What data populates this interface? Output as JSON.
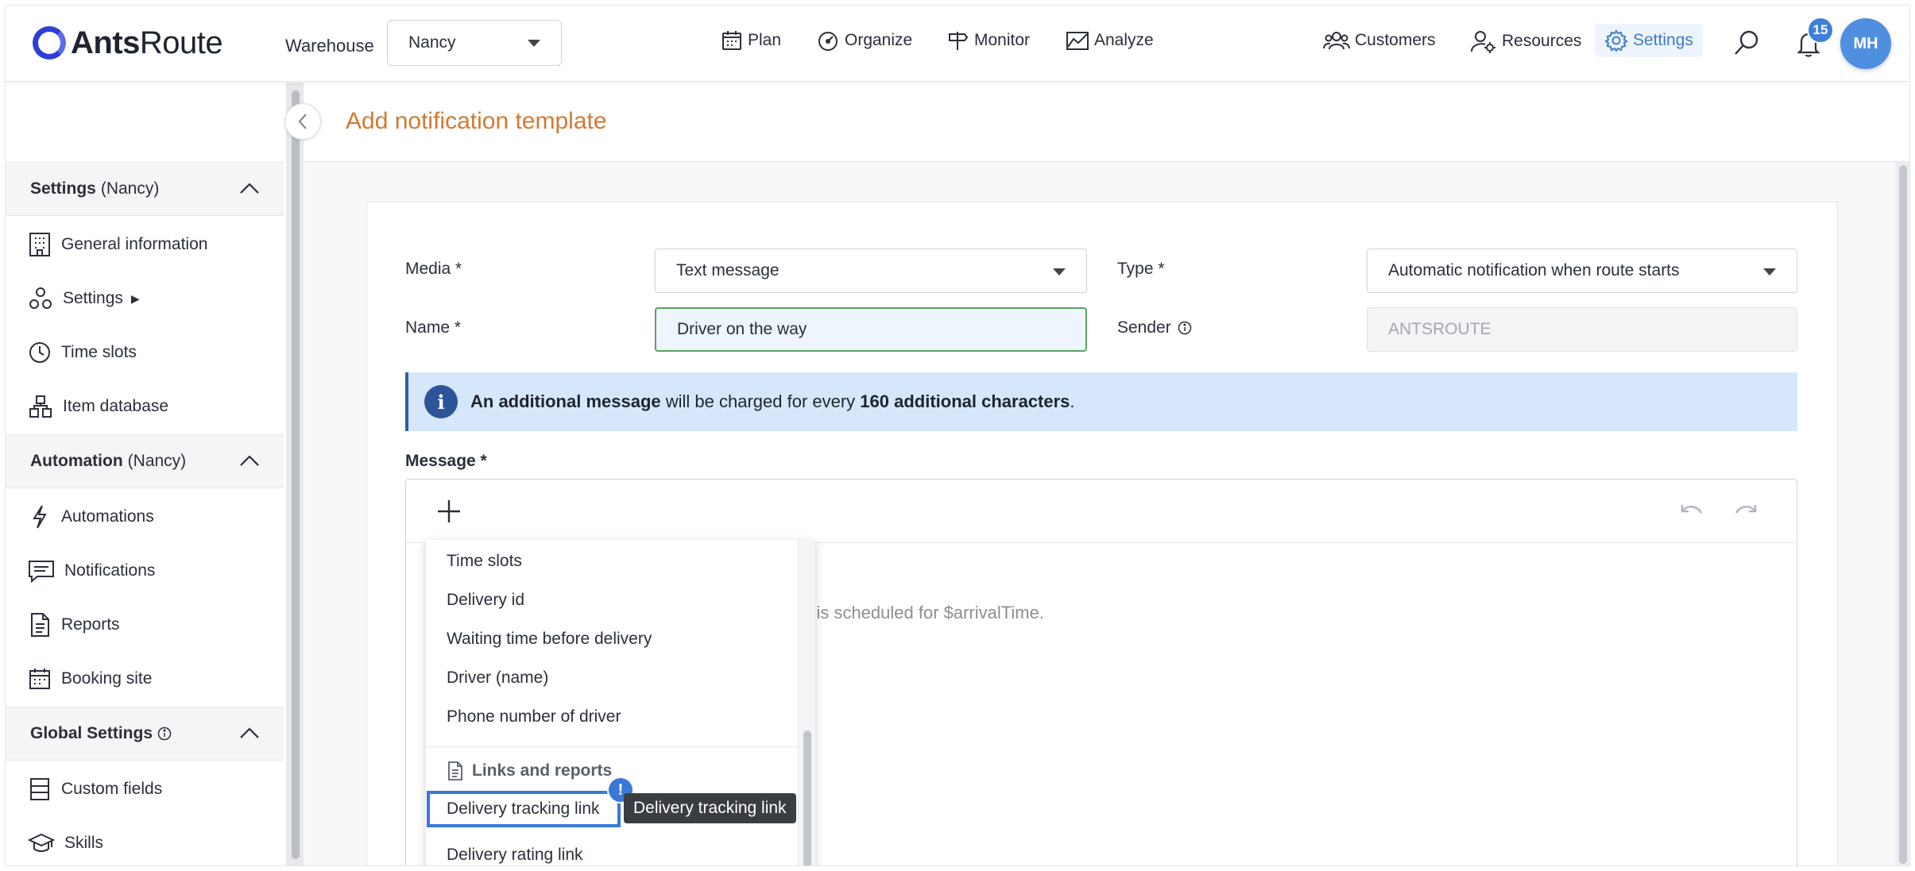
{
  "app": {
    "logo_bold": "Ants",
    "logo_light": "Route"
  },
  "header": {
    "warehouse_label": "Warehouse",
    "warehouse_value": "Nancy",
    "nav": {
      "plan": "Plan",
      "organize": "Organize",
      "monitor": "Monitor",
      "analyze": "Analyze",
      "customers": "Customers",
      "resources": "Resources",
      "settings": "Settings"
    },
    "notification_count": "15",
    "avatar_initials": "MH"
  },
  "sidebar": {
    "settings_section": {
      "title": "Settings",
      "scope": "(Nancy)"
    },
    "settings_items": [
      "General information",
      "Settings",
      "Time slots",
      "Item database"
    ],
    "automation_section": {
      "title": "Automation",
      "scope": "(Nancy)"
    },
    "automation_items": [
      "Automations",
      "Notifications",
      "Reports",
      "Booking site"
    ],
    "global_section": {
      "title": "Global Settings"
    },
    "global_items": [
      "Custom fields",
      "Skills"
    ]
  },
  "page": {
    "title": "Add notification template"
  },
  "form": {
    "media_label": "Media *",
    "media_value": "Text message",
    "type_label": "Type *",
    "type_value": "Automatic notification when route starts",
    "name_label": "Name *",
    "name_value": "Driver on the way",
    "sender_label": "Sender",
    "sender_value": "ANTSROUTE",
    "banner": {
      "bold1": "An additional message",
      "text1": " will be charged for every ",
      "bold2": "160 additional characters",
      "text2": "."
    },
    "message_label": "Message *",
    "message_visible_text": "ry is scheduled for $arrivalTime."
  },
  "dropdown": {
    "items": [
      "Time slots",
      "Delivery id",
      "Waiting time before delivery",
      "Driver (name)",
      "Phone number of driver"
    ],
    "group_label": "Links and reports",
    "selected_item": "Delivery tracking link",
    "next_item": "Delivery rating link",
    "tooltip": "Delivery tracking link",
    "alert_mark": "!"
  },
  "colors": {
    "accent_blue": "#3d7cc9",
    "title_orange": "#d17a33",
    "banner_bg": "#d6e7fb",
    "focus_green": "#5aa35e"
  }
}
